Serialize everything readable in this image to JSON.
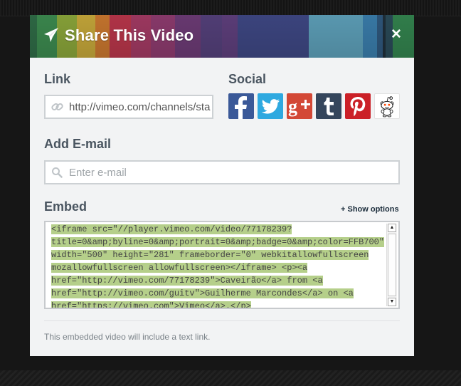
{
  "modal": {
    "title": "Share This Video",
    "close_label": "✕"
  },
  "link": {
    "label": "Link",
    "value": "http://vimeo.com/channels/sta"
  },
  "social": {
    "label": "Social",
    "buttons": [
      "facebook",
      "twitter",
      "google-plus",
      "tumblr",
      "pinterest",
      "reddit"
    ]
  },
  "email": {
    "label": "Add E-mail",
    "placeholder": "Enter e-mail"
  },
  "embed": {
    "label": "Embed",
    "show_options": "+ Show options",
    "code_lines": [
      "<iframe src=\"//player.vimeo.com/video/77178239?",
      "title=0&amp;byline=0&amp;portrait=0&amp;badge=0&amp;color=FFB700\"",
      "width=\"500\" height=\"281\" frameborder=\"0\" webkitallowfullscreen",
      "mozallowfullscreen allowfullscreen></iframe> <p><a",
      "href=\"http://vimeo.com/77178239\">Caveirão</a> from <a",
      "href=\"http://vimeo.com/guitv\">Guilherme Marcondes</a> on <a",
      "href=\"https://vimeo.com\">Vimeo</a>.</p>"
    ]
  },
  "footer_note": "This embedded video will include a text link.",
  "colors": {
    "facebook": "#3b5998",
    "twitter": "#2fa9e0",
    "google_plus": "#d34836",
    "tumblr": "#35465c",
    "pinterest": "#cb2027",
    "selection": "#b5cf8a"
  }
}
